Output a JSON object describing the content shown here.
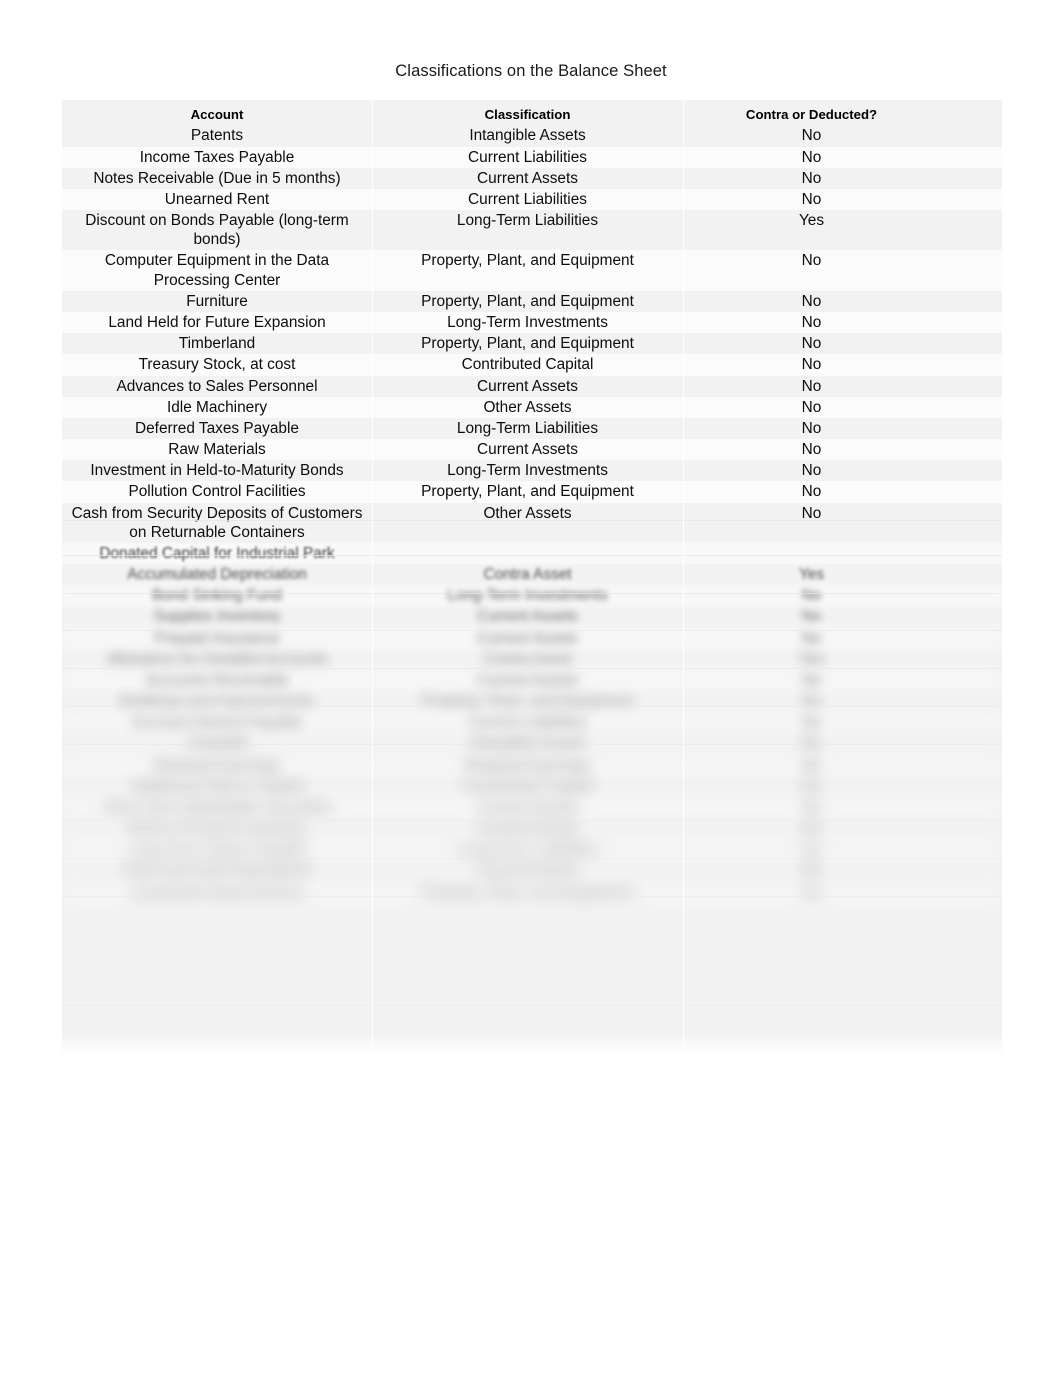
{
  "document": {
    "title": "Classifications on the Balance Sheet"
  },
  "table": {
    "headers": {
      "account": "Account",
      "classification": "Classification",
      "contra": "Contra or Deducted?"
    },
    "rows": [
      {
        "account": "Patents",
        "classification": "Intangible Assets",
        "contra": "No"
      },
      {
        "account": "Income Taxes Payable",
        "classification": "Current Liabilities",
        "contra": "No"
      },
      {
        "account": "Notes Receivable (Due in 5 months)",
        "classification": "Current Assets",
        "contra": "No"
      },
      {
        "account": "Unearned Rent",
        "classification": "Current Liabilities",
        "contra": "No"
      },
      {
        "account": "Discount on Bonds Payable (long-term bonds)",
        "classification": "Long-Term Liabilities",
        "contra": "Yes"
      },
      {
        "account": "Computer Equipment in the Data Processing Center",
        "classification": "Property, Plant, and Equipment",
        "contra": "No"
      },
      {
        "account": "Furniture",
        "classification": "Property, Plant, and Equipment",
        "contra": "No"
      },
      {
        "account": "Land Held for Future Expansion",
        "classification": "Long-Term Investments",
        "contra": "No"
      },
      {
        "account": "Timberland",
        "classification": "Property, Plant, and Equipment",
        "contra": "No"
      },
      {
        "account": "Treasury Stock, at cost",
        "classification": "Contributed Capital",
        "contra": "No"
      },
      {
        "account": "Advances to Sales Personnel",
        "classification": "Current Assets",
        "contra": "No"
      },
      {
        "account": "Idle Machinery",
        "classification": "Other Assets",
        "contra": "No"
      },
      {
        "account": "Deferred Taxes Payable",
        "classification": "Long-Term Liabilities",
        "contra": "No"
      },
      {
        "account": "Raw Materials",
        "classification": "Current Assets",
        "contra": "No"
      },
      {
        "account": "Investment in Held-to-Maturity Bonds",
        "classification": "Long-Term Investments",
        "contra": "No"
      },
      {
        "account": "Pollution Control Facilities",
        "classification": "Property, Plant, and Equipment",
        "contra": "No"
      },
      {
        "account": "Cash from Security Deposits of Customers on Returnable Containers",
        "classification": "Other Assets",
        "contra": "No"
      },
      {
        "account": "Donated Capital for Industrial Park",
        "classification": "",
        "contra": ""
      }
    ],
    "obscured_rows": [
      {
        "account": "",
        "classification": "",
        "contra": ""
      },
      {
        "account": "",
        "classification": "",
        "contra": ""
      },
      {
        "account": "",
        "classification": "",
        "contra": ""
      },
      {
        "account": "",
        "classification": "",
        "contra": ""
      },
      {
        "account": "",
        "classification": "",
        "contra": ""
      },
      {
        "account": "",
        "classification": "",
        "contra": ""
      },
      {
        "account": "",
        "classification": "",
        "contra": ""
      },
      {
        "account": "",
        "classification": "",
        "contra": ""
      },
      {
        "account": "",
        "classification": "",
        "contra": ""
      },
      {
        "account": "",
        "classification": "",
        "contra": ""
      },
      {
        "account": "",
        "classification": "",
        "contra": ""
      },
      {
        "account": "",
        "classification": "",
        "contra": ""
      },
      {
        "account": "",
        "classification": "",
        "contra": ""
      },
      {
        "account": "",
        "classification": "",
        "contra": ""
      },
      {
        "account": "",
        "classification": "",
        "contra": ""
      },
      {
        "account": "",
        "classification": "",
        "contra": ""
      }
    ]
  }
}
